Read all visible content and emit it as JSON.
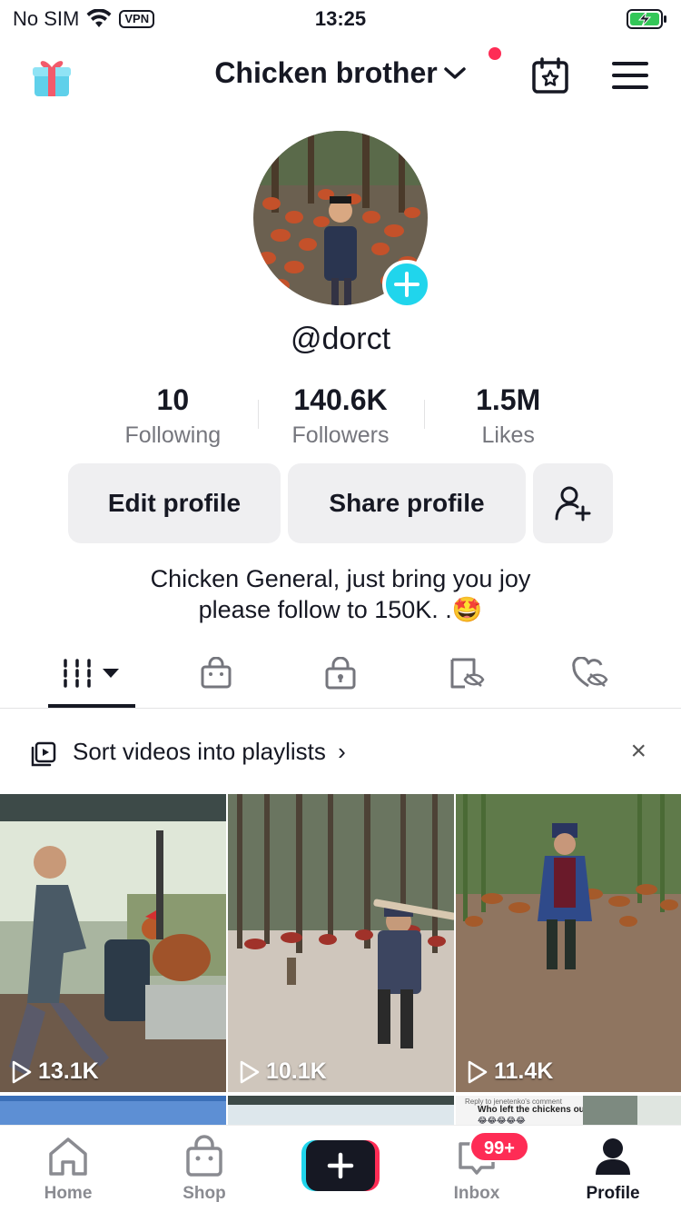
{
  "status_bar": {
    "carrier": "No SIM",
    "vpn_label": "VPN",
    "time": "13:25"
  },
  "header": {
    "title": "Chicken brother",
    "accent_red": "#fe2c55"
  },
  "profile": {
    "username": "@dorct",
    "stats": [
      {
        "value": "10",
        "label": "Following"
      },
      {
        "value": "140.6K",
        "label": "Followers"
      },
      {
        "value": "1.5M",
        "label": "Likes"
      }
    ],
    "edit_button": "Edit profile",
    "share_button": "Share profile",
    "bio_line1": "Chicken General, just bring you joy",
    "bio_line2": "please follow to 150K. .🤩",
    "badge_color": "#20d5ec"
  },
  "tabs": [
    {
      "icon": "grid-icon",
      "active": true
    },
    {
      "icon": "shop-bag-icon"
    },
    {
      "icon": "lock-icon"
    },
    {
      "icon": "hidden-reposts-icon"
    },
    {
      "icon": "hidden-likes-icon"
    }
  ],
  "playlist_banner": {
    "text": "Sort videos into playlists",
    "chevron": "›",
    "close": "×"
  },
  "videos": [
    {
      "views": "13.1K"
    },
    {
      "views": "10.1K"
    },
    {
      "views": "11.4K"
    }
  ],
  "partial_row": {
    "comment_header": "Reply to jenetenko's comment",
    "comment_text": "Who left the chickens out.",
    "comment_emojis": "😂😂😂😂😂"
  },
  "bottom_nav": {
    "home": "Home",
    "shop": "Shop",
    "inbox": "Inbox",
    "inbox_badge": "99+",
    "profile": "Profile"
  }
}
